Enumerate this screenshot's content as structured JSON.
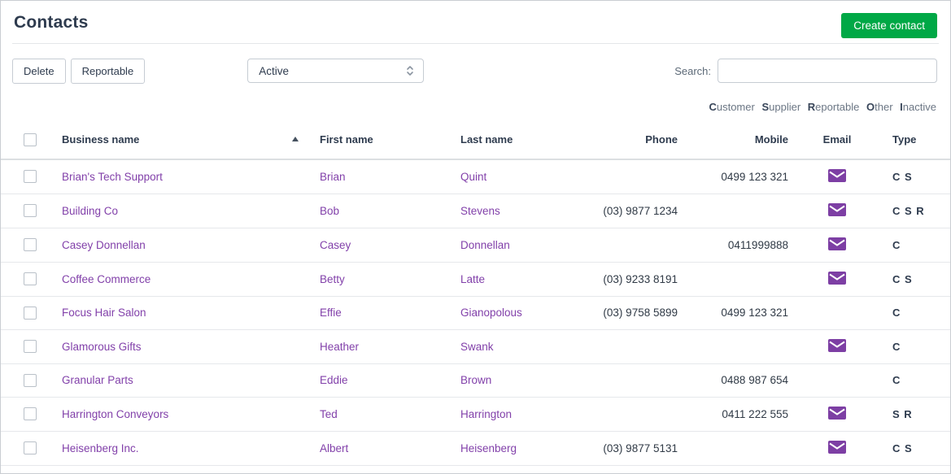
{
  "colors": {
    "accent_green": "#00a846",
    "link_purple": "#8241aa",
    "email_icon_purple": "#7d3fa4"
  },
  "page": {
    "title": "Contacts"
  },
  "actions": {
    "create_contact": "Create contact"
  },
  "toolbar": {
    "delete_label": "Delete",
    "reportable_label": "Reportable",
    "status_filter": {
      "value": "Active"
    },
    "search": {
      "label": "Search:",
      "value": ""
    }
  },
  "legend": {
    "items": [
      {
        "initial": "C",
        "rest": "ustomer"
      },
      {
        "initial": "S",
        "rest": "upplier"
      },
      {
        "initial": "R",
        "rest": "eportable"
      },
      {
        "initial": "O",
        "rest": "ther"
      },
      {
        "initial": "I",
        "rest": "nactive"
      }
    ]
  },
  "table": {
    "headers": {
      "business": "Business name",
      "first": "First name",
      "last": "Last name",
      "phone": "Phone",
      "mobile": "Mobile",
      "email": "Email",
      "type": "Type"
    },
    "sort": {
      "column": "business",
      "direction": "asc"
    },
    "rows": [
      {
        "business": "Brian's Tech Support",
        "first": "Brian",
        "last": "Quint",
        "phone": "",
        "mobile": "0499 123 321",
        "has_email": true,
        "type": "C S"
      },
      {
        "business": "Building Co",
        "first": "Bob",
        "last": "Stevens",
        "phone": "(03) 9877 1234",
        "mobile": "",
        "has_email": true,
        "type": "C S R"
      },
      {
        "business": "Casey Donnellan",
        "first": "Casey",
        "last": "Donnellan",
        "phone": "",
        "mobile": "0411999888",
        "has_email": true,
        "type": "C"
      },
      {
        "business": "Coffee Commerce",
        "first": "Betty",
        "last": "Latte",
        "phone": "(03) 9233 8191",
        "mobile": "",
        "has_email": true,
        "type": "C S"
      },
      {
        "business": "Focus Hair Salon",
        "first": "Effie",
        "last": "Gianopolous",
        "phone": "(03) 9758 5899",
        "mobile": "0499 123 321",
        "has_email": false,
        "type": "C"
      },
      {
        "business": "Glamorous Gifts",
        "first": "Heather",
        "last": "Swank",
        "phone": "",
        "mobile": "",
        "has_email": true,
        "type": "C"
      },
      {
        "business": "Granular Parts",
        "first": "Eddie",
        "last": "Brown",
        "phone": "",
        "mobile": "0488 987 654",
        "has_email": false,
        "type": "C"
      },
      {
        "business": "Harrington Conveyors",
        "first": "Ted",
        "last": "Harrington",
        "phone": "",
        "mobile": "0411 222 555",
        "has_email": true,
        "type": "S R"
      },
      {
        "business": "Heisenberg Inc.",
        "first": "Albert",
        "last": "Heisenberg",
        "phone": "(03) 9877 5131",
        "mobile": "",
        "has_email": true,
        "type": "C S"
      }
    ]
  }
}
